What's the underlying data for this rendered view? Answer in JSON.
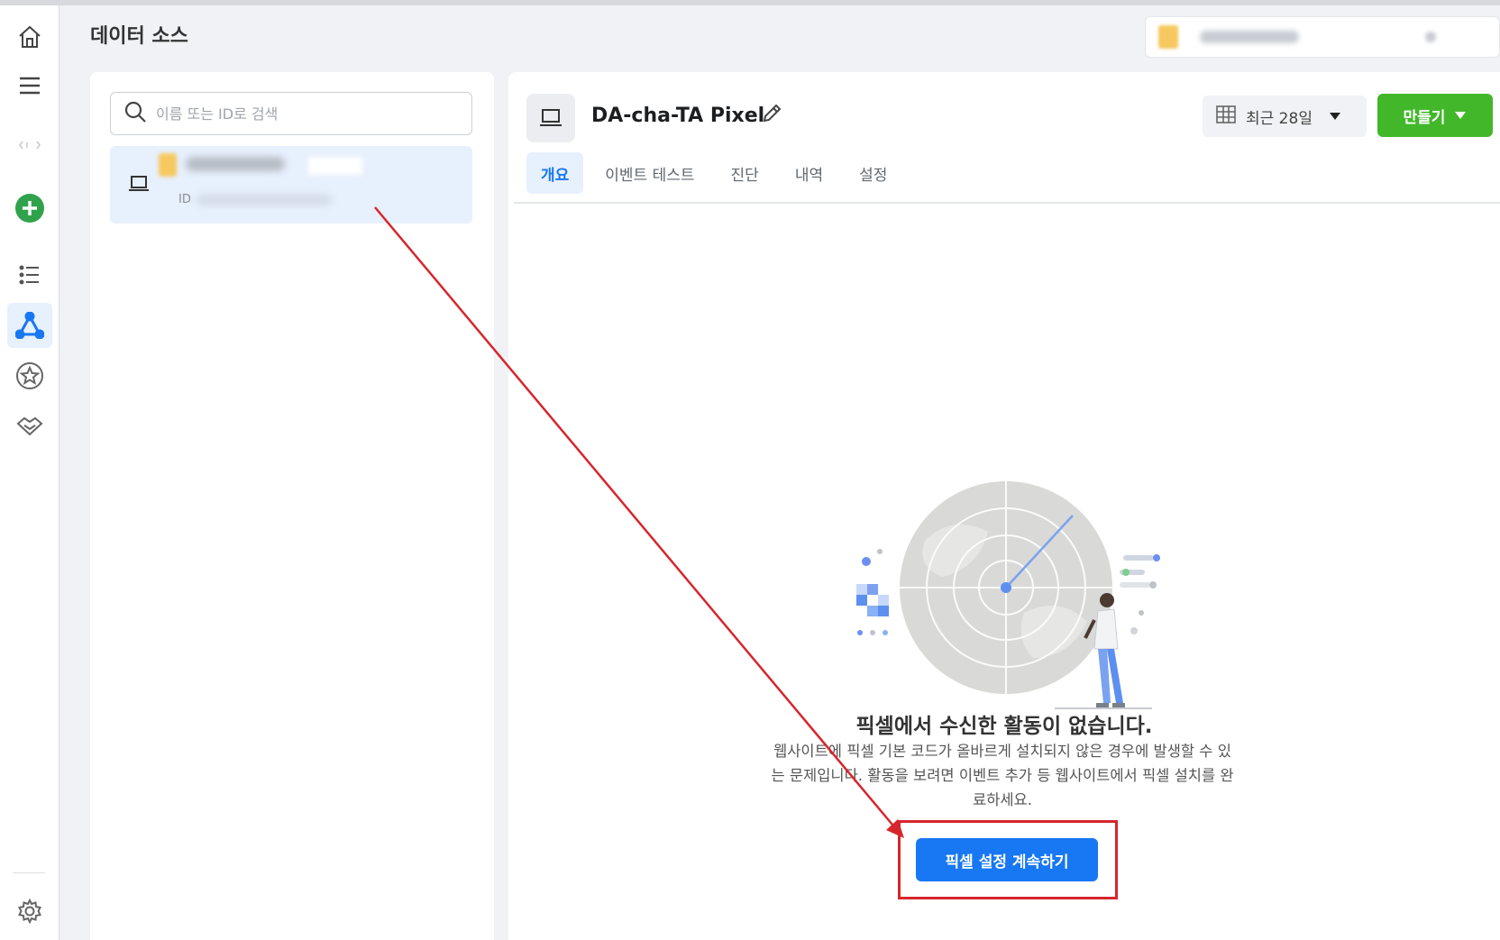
{
  "header": {
    "title": "데이터 소스"
  },
  "search": {
    "placeholder": "이름 또는 ID로 검색"
  },
  "source_item": {
    "id_label": "ID"
  },
  "detail": {
    "pixel_name": "DA-cha-TA Pixel",
    "date_range": "최근 28일",
    "create_label": "만들기",
    "tabs": [
      {
        "label": "개요",
        "active": true
      },
      {
        "label": "이벤트 테스트",
        "active": false
      },
      {
        "label": "진단",
        "active": false
      },
      {
        "label": "내역",
        "active": false
      },
      {
        "label": "설정",
        "active": false
      }
    ],
    "empty_title": "픽셀에서 수신한 활동이 없습니다.",
    "empty_desc": "웹사이트에 픽셀 기본 코드가 올바르게 설치되지 않은 경우에 발생할 수 있는 문제입니다. 활동을 보려면 이벤트 추가 등 웹사이트에서 픽셀 설치를 완료하세요.",
    "continue_label": "픽셀 설정 계속하기"
  },
  "colors": {
    "accent": "#1877f2",
    "create_green": "#42b72a",
    "annotation_red": "#d6262c",
    "active_bg": "#e7f0fd"
  },
  "icons": {
    "rail": [
      "home-icon",
      "menu-icon",
      "collapse-icon",
      "add-icon",
      "list-icon",
      "data-sources-icon",
      "star-icon",
      "handshake-icon",
      "gear-icon"
    ],
    "list": [
      "search-icon",
      "computer-icon"
    ],
    "detail": [
      "computer-icon",
      "pencil-icon",
      "calendar-grid-icon",
      "caret-down-icon"
    ]
  }
}
